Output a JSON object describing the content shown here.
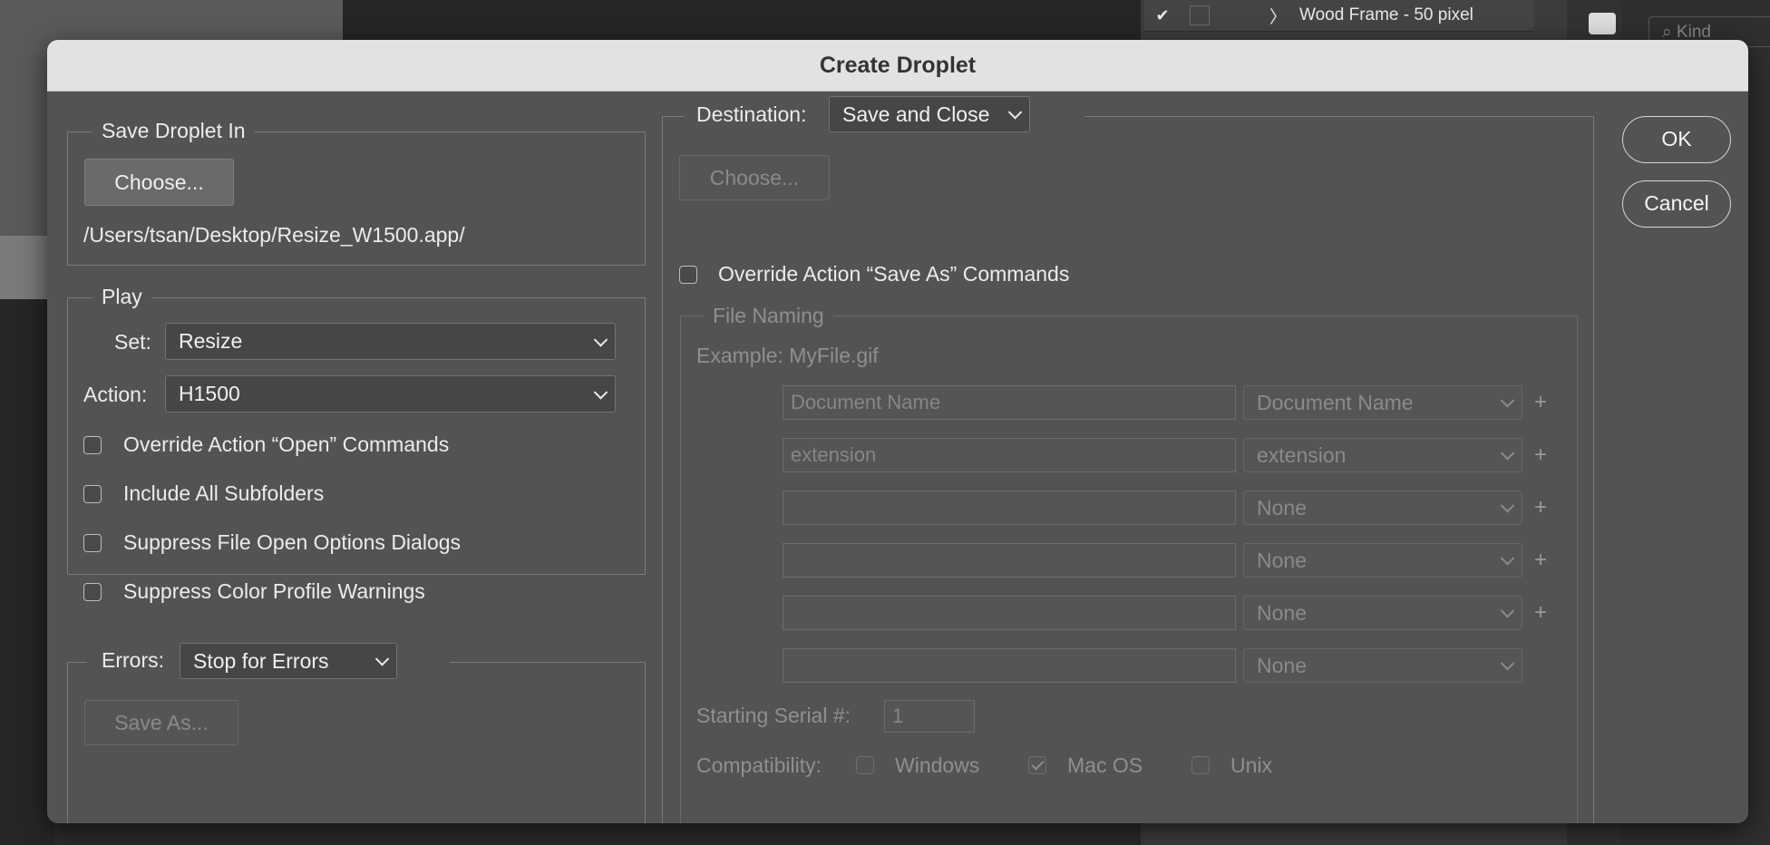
{
  "background": {
    "layer_row": {
      "check": "✔",
      "arrow": "〉",
      "label": "Wood Frame - 50 pixel"
    },
    "search_placeholder": "Kind"
  },
  "dialog": {
    "title": "Create Droplet",
    "ok_label": "OK",
    "cancel_label": "Cancel",
    "save_in": {
      "legend": "Save Droplet In",
      "choose_label": "Choose...",
      "path": "/Users/tsan/Desktop/Resize_W1500.app/"
    },
    "play": {
      "legend": "Play",
      "set_label": "Set:",
      "set_value": "Resize",
      "action_label": "Action:",
      "action_value": "H1500",
      "options": [
        {
          "label": "Override Action “Open” Commands",
          "checked": false
        },
        {
          "label": "Include All Subfolders",
          "checked": false
        },
        {
          "label": "Suppress File Open Options Dialogs",
          "checked": false
        },
        {
          "label": "Suppress Color Profile Warnings",
          "checked": false
        }
      ]
    },
    "errors": {
      "label": "Errors:",
      "value": "Stop for Errors",
      "save_as_label": "Save As..."
    },
    "destination": {
      "label": "Destination:",
      "value": "Save and Close",
      "choose_label": "Choose...",
      "override_label": "Override Action “Save As” Commands",
      "override_checked": false
    },
    "file_naming": {
      "legend": "File Naming",
      "example": "Example: MyFile.gif",
      "rows": [
        {
          "text": "Document Name",
          "select": "Document Name"
        },
        {
          "text": "extension",
          "select": "extension"
        },
        {
          "text": "",
          "select": "None"
        },
        {
          "text": "",
          "select": "None"
        },
        {
          "text": "",
          "select": "None"
        },
        {
          "text": "",
          "select": "None"
        }
      ],
      "plus": "+",
      "serial_label": "Starting Serial #:",
      "serial_value": "1",
      "compat_label": "Compatibility:",
      "compat": [
        {
          "label": "Windows",
          "checked": false
        },
        {
          "label": "Mac OS",
          "checked": true
        },
        {
          "label": "Unix",
          "checked": false
        }
      ]
    }
  }
}
